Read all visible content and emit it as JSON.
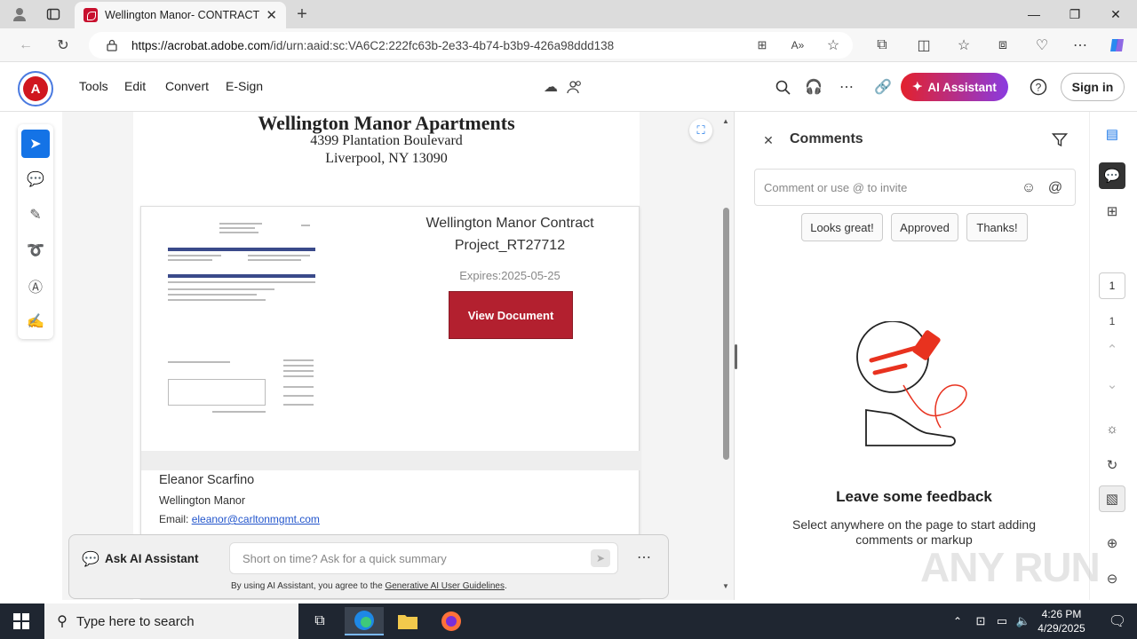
{
  "browser": {
    "tab_title": "Wellington Manor- CONTRACT P",
    "url_host": "https://acrobat.adobe.com",
    "url_path": "/id/urn:aaid:sc:VA6C2:222fc63b-2e33-4b74-b3b9-426a98ddd138"
  },
  "toolbar": {
    "menu": [
      "Tools",
      "Edit",
      "Convert",
      "E-Sign"
    ],
    "ai_button": "AI Assistant",
    "sign_in": "Sign in"
  },
  "document": {
    "header_title": "Wellington Manor Apartments",
    "address_line1": "4399 Plantation Boulevard",
    "address_line2": "Liverpool, NY 13090",
    "card_title": "Wellington Manor Contract Project_RT27712",
    "expires": "Expires:2025-05-25",
    "view_button": "View Document",
    "contact_name": "Eleanor Scarfino",
    "contact_company": "Wellington Manor",
    "email_label": "Email: ",
    "email_value": "eleanor@carltonmgmt.com"
  },
  "ai_bar": {
    "label": "Ask AI Assistant",
    "placeholder": "Short on time? Ask for a quick summary",
    "note_prefix": "By using AI Assistant, you agree to the ",
    "note_link": "Generative AI User Guidelines",
    "note_suffix": "."
  },
  "comments": {
    "title": "Comments",
    "placeholder": "Comment or use @ to invite",
    "chips": [
      "Looks great!",
      "Approved",
      "Thanks!"
    ],
    "feedback_title": "Leave some feedback",
    "feedback_text": "Select anywhere on the page to start adding comments or markup"
  },
  "page_nav": {
    "current": "1",
    "total": "1"
  },
  "watermark": "ANY RUN",
  "taskbar": {
    "search_placeholder": "Type here to search",
    "time": "4:26 PM",
    "date": "4/29/2025"
  },
  "colors": {
    "accent": "#1473e6",
    "brand_red": "#d0171f",
    "view_button": "#b3202f"
  }
}
